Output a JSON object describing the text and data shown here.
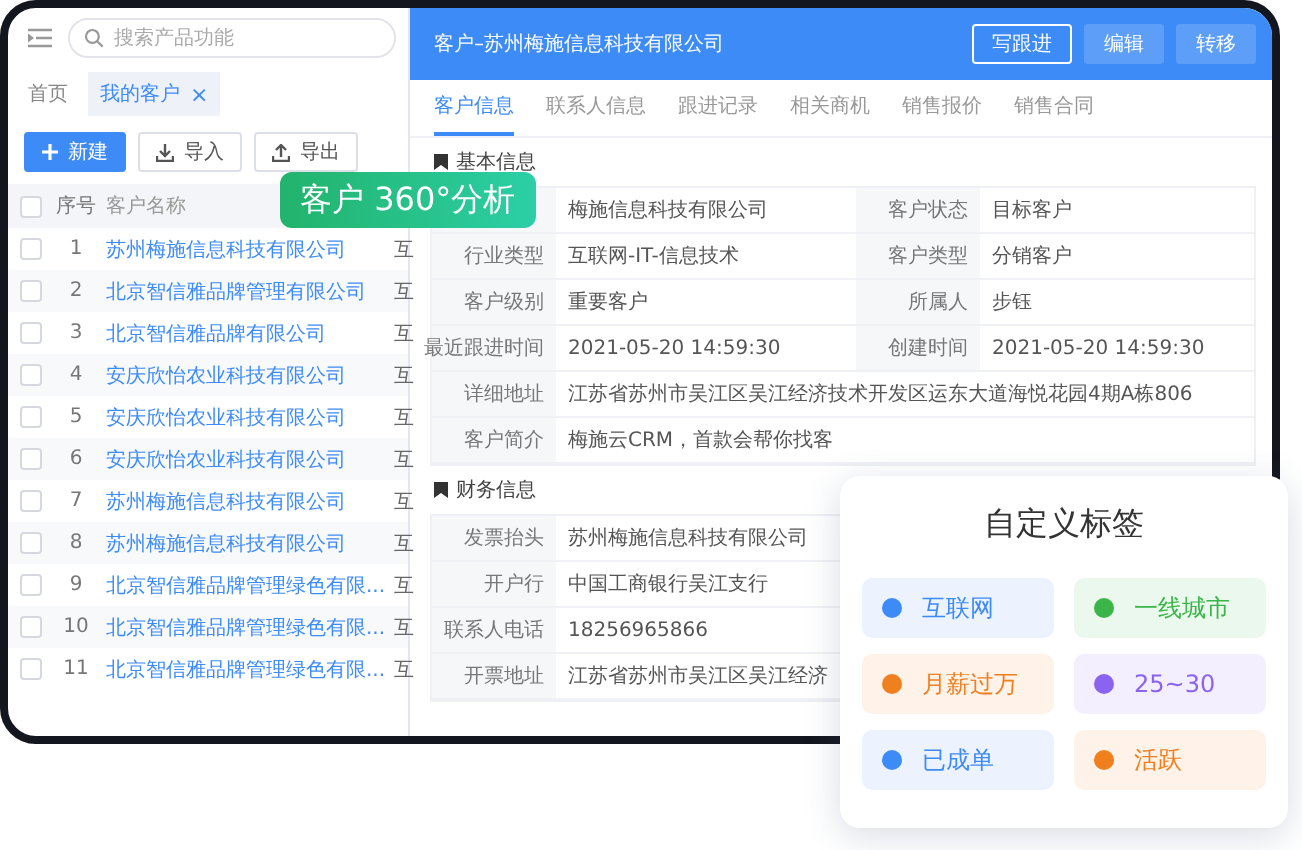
{
  "sidebar": {
    "search": {
      "placeholder": "搜索产品功能"
    },
    "tabs": [
      {
        "label": "首页",
        "selected": false
      },
      {
        "label": "我的客户",
        "selected": true,
        "close": "×"
      }
    ],
    "buttons": [
      {
        "label": "新建",
        "kind": "primary"
      },
      {
        "label": "导入",
        "kind": "import"
      },
      {
        "label": "导出",
        "kind": "export"
      }
    ],
    "table": {
      "all_checked": false,
      "columns": [
        "序号",
        "客户名称"
      ],
      "rows": [
        {
          "checked": false,
          "index": "1",
          "name": "苏州梅施信息科技有限公司",
          "column_3": "互"
        },
        {
          "checked": false,
          "index": "2",
          "name": "北京智信雅品牌管理有限公司",
          "column_3": "互"
        },
        {
          "checked": false,
          "index": "3",
          "name": "北京智信雅品牌有限公司",
          "column_3": "互"
        },
        {
          "checked": false,
          "index": "4",
          "name": "安庆欣怡农业科技有限公司",
          "column_3": "互"
        },
        {
          "checked": false,
          "index": "5",
          "name": "安庆欣怡农业科技有限公司",
          "column_3": "互"
        },
        {
          "checked": false,
          "index": "6",
          "name": "安庆欣怡农业科技有限公司",
          "column_3": "互"
        },
        {
          "checked": false,
          "index": "7",
          "name": "苏州梅施信息科技有限公司",
          "column_3": "互"
        },
        {
          "checked": false,
          "index": "8",
          "name": "苏州梅施信息科技有限公司",
          "column_3": "互"
        },
        {
          "checked": false,
          "index": "9",
          "name": "北京智信雅品牌管理绿色有限...",
          "column_3": "互"
        },
        {
          "checked": false,
          "index": "10",
          "name": "北京智信雅品牌管理绿色有限...",
          "column_3": "互"
        },
        {
          "checked": false,
          "index": "11",
          "name": "北京智信雅品牌管理绿色有限...",
          "column_3": "互"
        }
      ]
    }
  },
  "detail": {
    "title": "客户–苏州梅施信息科技有限公司",
    "actions": [
      {
        "label": "写跟进",
        "kind": "outline"
      },
      {
        "label": "编辑",
        "kind": "solid"
      },
      {
        "label": "转移",
        "kind": "solid"
      }
    ],
    "tabs": [
      {
        "label": "客户信息",
        "selected": true
      },
      {
        "label": "联系人信息",
        "selected": false
      },
      {
        "label": "跟进记录",
        "selected": false
      },
      {
        "label": "相关商机",
        "selected": false
      },
      {
        "label": "销售报价",
        "selected": false
      },
      {
        "label": "销售合同",
        "selected": false
      }
    ],
    "sections": [
      {
        "title": "基本信息",
        "rows": [
          {
            "cells": [
              {
                "value": "梅施信息科技有限公司"
              },
              {
                "label": "客户状态",
                "value": "目标客户"
              }
            ]
          },
          {
            "cells": [
              {
                "label": "行业类型",
                "value": "互联网-IT-信息技术"
              },
              {
                "label": "客户类型",
                "value": "分销客户"
              }
            ]
          },
          {
            "cells": [
              {
                "label": "客户级别",
                "value": "重要客户"
              },
              {
                "label": "所属人",
                "value": "步钰"
              }
            ]
          },
          {
            "cells": [
              {
                "label": "最近跟进时间",
                "value": "2021-05-20 14:59:30"
              },
              {
                "label": "创建时间",
                "value": "2021-05-20 14:59:30"
              }
            ]
          },
          {
            "cells": [
              {
                "label": "详细地址",
                "value": "江苏省苏州市吴江区吴江经济技术开发区运东大道海悦花园4期A栋806"
              }
            ]
          },
          {
            "cells": [
              {
                "label": "客户简介",
                "value": "梅施云CRM，首款会帮你找客"
              }
            ]
          }
        ]
      },
      {
        "title": "财务信息",
        "rows": [
          {
            "cells": [
              {
                "label": "发票抬头",
                "value": "苏州梅施信息科技有限公司"
              }
            ]
          },
          {
            "cells": [
              {
                "label": "开户行",
                "value": "中国工商银行吴江支行"
              }
            ]
          },
          {
            "cells": [
              {
                "label": "联系人电话",
                "value": "18256965866"
              }
            ]
          },
          {
            "cells": [
              {
                "label": "开票地址",
                "value": "江苏省苏州市吴江区吴江经济"
              }
            ]
          }
        ]
      }
    ]
  },
  "badge": {
    "text": "客户 360°分析"
  },
  "tag_card": {
    "title": "自定义标签",
    "tags": [
      {
        "label": "互联网",
        "color": "#3d8bf7"
      },
      {
        "label": "一线城市",
        "color": "#3bb54a"
      },
      {
        "label": "月薪过万",
        "color": "#f07f1e"
      },
      {
        "label": "25~30",
        "color": "#8a63f0"
      },
      {
        "label": "已成单",
        "color": "#3d8bf7"
      },
      {
        "label": "活跃",
        "color": "#f07f1e"
      }
    ]
  }
}
